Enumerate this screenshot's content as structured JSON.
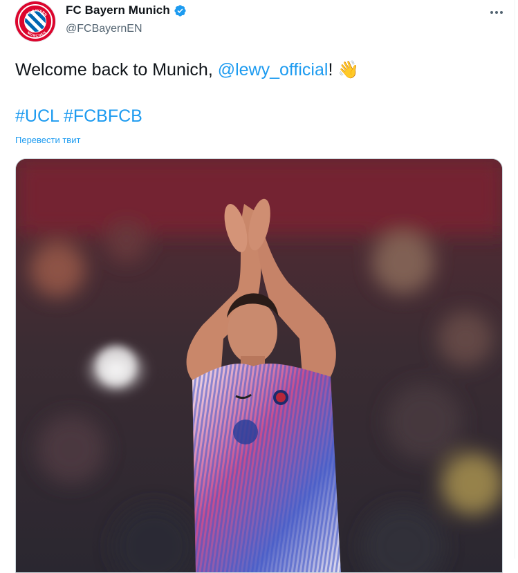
{
  "account": {
    "name": "FC Bayern Munich",
    "handle": "@FCBayernEN",
    "verified": true,
    "avatar_text": "FC BAYERN MÜNCHEN",
    "avatar_colors": {
      "red": "#dc052d",
      "blue": "#0066b2"
    }
  },
  "tweet": {
    "text_before": "Welcome back to Munich, ",
    "mention": "@lewy_official",
    "text_after": "! ",
    "emoji": "👋",
    "hashtag_1": "#UCL",
    "hashtag_2": "#FCBFCB",
    "translate_label": "Перевести твит"
  },
  "media": {
    "icon": "photo",
    "description_kind": "image"
  },
  "colors": {
    "link": "#1d9bf0",
    "secondary_text": "#536471",
    "primary_text": "#0f1419"
  },
  "icons": {
    "verified": "verified-badge-icon",
    "more": "more-options-icon"
  }
}
